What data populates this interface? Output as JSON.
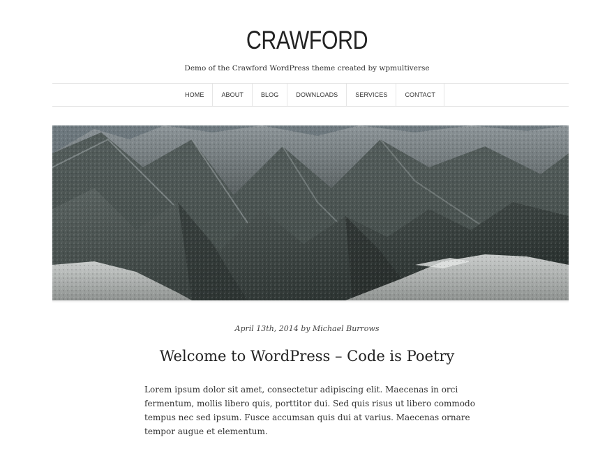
{
  "site": {
    "title": "CRAWFORD",
    "description": "Demo of the Crawford WordPress theme created by wpmultiverse"
  },
  "nav": {
    "items": [
      "HOME",
      "ABOUT",
      "BLOG",
      "DOWNLOADS",
      "SERVICES",
      "CONTACT"
    ]
  },
  "hero": {
    "image": "mountain-landscape"
  },
  "post": {
    "meta": "April 13th, 2014 by Michael Burrows",
    "title": "Welcome to WordPress – Code is Poetry",
    "body": "Lorem ipsum dolor sit amet, consectetur adipiscing elit. Maecenas in orci fermentum, mollis libero quis, porttitor dui. Sed quis risus ut libero commodo tempus nec sed ipsum. Fusce accumsan quis dui at varius. Maecenas ornare tempor augue et elementum."
  }
}
